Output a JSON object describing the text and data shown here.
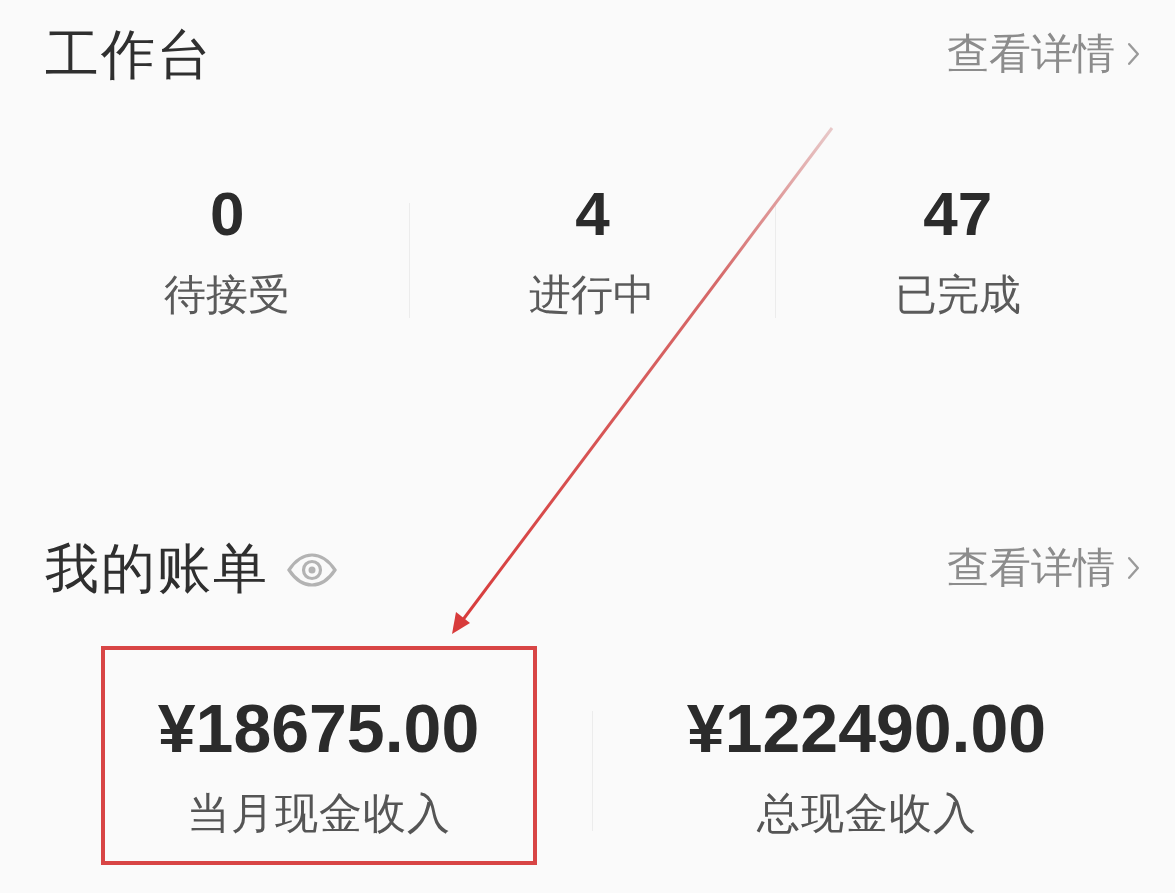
{
  "workbench": {
    "title": "工作台",
    "details_link": "查看详情",
    "stats": [
      {
        "value": "0",
        "label": "待接受"
      },
      {
        "value": "4",
        "label": "进行中"
      },
      {
        "value": "47",
        "label": "已完成"
      }
    ]
  },
  "bills": {
    "title": "我的账单",
    "details_link": "查看详情",
    "items": [
      {
        "amount": "¥18675.00",
        "label": "当月现金收入",
        "highlighted": true
      },
      {
        "amount": "¥122490.00",
        "label": "总现金收入",
        "highlighted": false
      }
    ]
  }
}
